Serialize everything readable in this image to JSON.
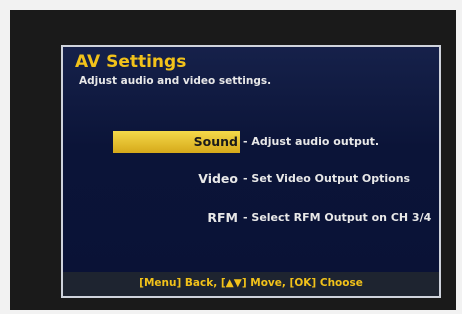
{
  "header": {
    "title": "AV Settings",
    "subtitle": "Adjust audio and video settings."
  },
  "menu": {
    "items": [
      {
        "label": "Sound",
        "description": "- Adjust audio output.",
        "selected": true
      },
      {
        "label": "Video",
        "description": "- Set Video Output Options",
        "selected": false
      },
      {
        "label": "RFM",
        "description": "- Select RFM Output on CH 3/4",
        "selected": false
      }
    ]
  },
  "footer": {
    "hint": "[Menu] Back, [▲▼] Move, [OK] Choose"
  },
  "colors": {
    "title": "#f2c21a",
    "highlight": "#e8c230",
    "panel_bg": "#0b1438",
    "footer_text": "#f2c21a"
  }
}
